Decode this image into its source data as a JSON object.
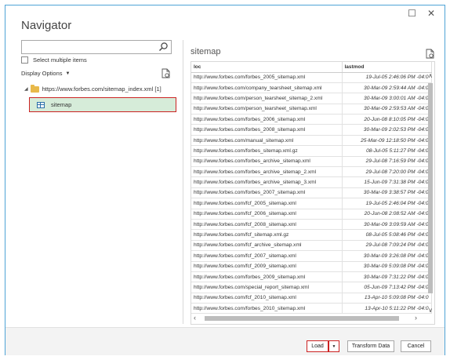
{
  "window": {
    "title": "Navigator",
    "maximize_glyph": "☐",
    "close_glyph": "✕"
  },
  "left": {
    "search_placeholder": "",
    "select_multiple_label": "Select multiple items",
    "display_options_label": "Display Options",
    "root_label": "https://www.forbes.com/sitemap_index.xml [1]",
    "selected_item_label": "sitemap"
  },
  "preview": {
    "title": "sitemap",
    "columns": [
      "loc",
      "lastmod"
    ],
    "rows": [
      [
        "http://www.forbes.com/forbes_2005_sitemap.xml",
        "19-Jul-05 2:46:06 PM -04:0"
      ],
      [
        "http://www.forbes.com/company_tearsheet_sitemap.xml",
        "30-Mar-09 2:59:44 AM -04:0"
      ],
      [
        "http://www.forbes.com/person_tearsheet_sitemap_2.xml",
        "30-Mar-09 3:00:01 AM -04:0"
      ],
      [
        "http://www.forbes.com/person_tearsheet_sitemap.xml",
        "30-Mar-09 2:59:53 AM -04:0"
      ],
      [
        "http://www.forbes.com/forbes_2006_sitemap.xml",
        "20-Jun-08 8:10:05 PM -04:0"
      ],
      [
        "http://www.forbes.com/forbes_2008_sitemap.xml",
        "30-Mar-09 2:02:53 PM -04:0"
      ],
      [
        "http://www.forbes.com/manual_sitemap.xml",
        "25-Mar-09 12:18:50 PM -04:0"
      ],
      [
        "http://www.forbes.com/forbes_sitemap.xml.gz",
        "08-Jul-05 5:11:27 PM -04:0"
      ],
      [
        "http://www.forbes.com/forbes_archive_sitemap.xml",
        "29-Jul-08 7:16:59 PM -04:0"
      ],
      [
        "http://www.forbes.com/forbes_archive_sitemap_2.xml",
        "29-Jul-08 7:20:00 PM -04:0"
      ],
      [
        "http://www.forbes.com/forbes_archive_sitemap_3.xml",
        "15-Jun-09 7:31:38 PM -04:0"
      ],
      [
        "http://www.forbes.com/forbes_2007_sitemap.xml",
        "30-Mar-09 3:38:57 PM -04:0"
      ],
      [
        "http://www.forbes.com/fcf_2005_sitemap.xml",
        "19-Jul-05 2:46:04 PM -04:0"
      ],
      [
        "http://www.forbes.com/fcf_2006_sitemap.xml",
        "20-Jun-08 2:08:52 AM -04:0"
      ],
      [
        "http://www.forbes.com/fcf_2008_sitemap.xml",
        "30-Mar-09 3:09:59 AM -04:0"
      ],
      [
        "http://www.forbes.com/fcf_sitemap.xml.gz",
        "08-Jul-05 5:08:46 PM -04:0"
      ],
      [
        "http://www.forbes.com/fcf_archive_sitemap.xml",
        "29-Jul-08 7:09:24 PM -04:0"
      ],
      [
        "http://www.forbes.com/fcf_2007_sitemap.xml",
        "30-Mar-09 3:26:08 PM -04:0"
      ],
      [
        "http://www.forbes.com/fcf_2009_sitemap.xml",
        "30-Mar-09 5:09:08 PM -04:0"
      ],
      [
        "http://www.forbes.com/forbes_2009_sitemap.xml",
        "30-Mar-09 7:31:22 PM -04:0"
      ],
      [
        "http://www.forbes.com/special_report_sitemap.xml",
        "05-Jun-09 7:13:42 PM -04:0"
      ],
      [
        "http://www.forbes.com/fcf_2010_sitemap.xml",
        "13-Apr-10 5:09:08 PM -04:0"
      ],
      [
        "http://www.forbes.com/forbes_2010_sitemap.xml",
        "13-Apr-10 5:11:22 PM -04:0"
      ]
    ]
  },
  "footer": {
    "load_label": "Load",
    "transform_label": "Transform Data",
    "cancel_label": "Cancel"
  },
  "colors": {
    "frame_border": "#4fa3d6",
    "selection_bg": "#d6ecd9",
    "highlight_border": "#cc2222"
  }
}
